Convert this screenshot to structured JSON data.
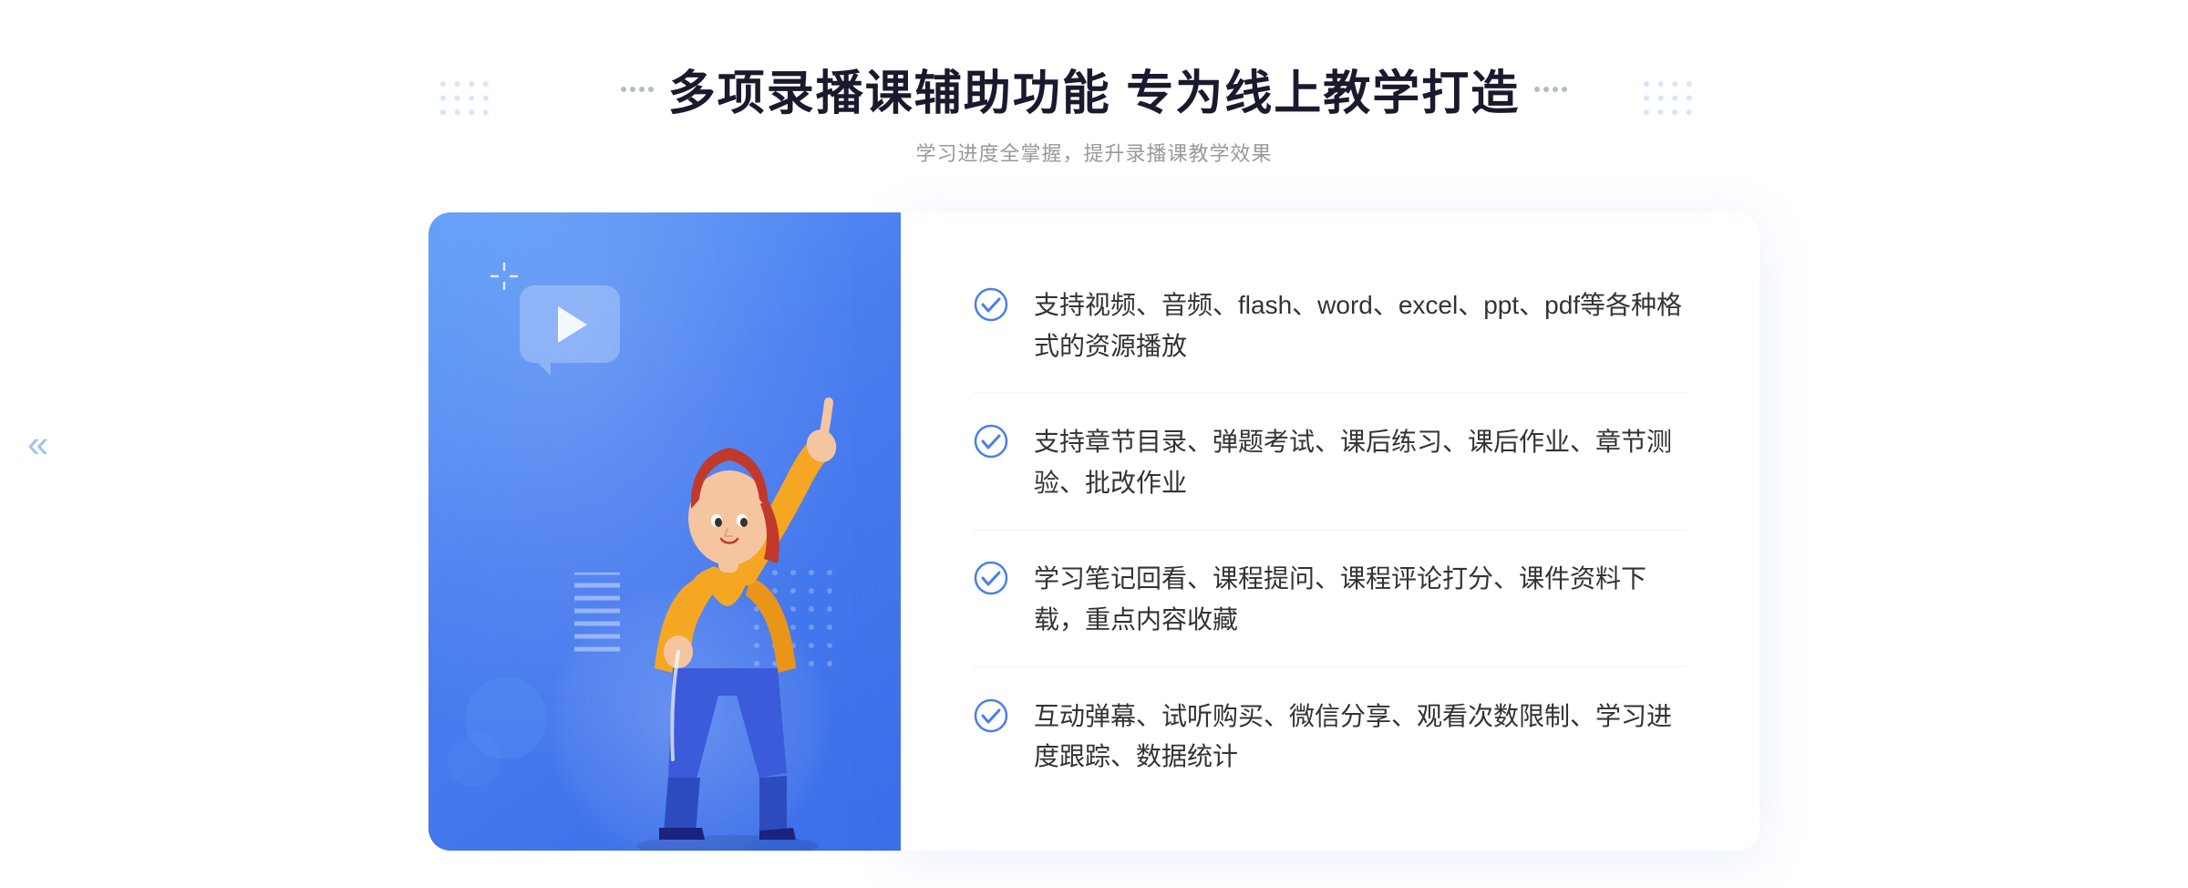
{
  "page": {
    "background": "#ffffff"
  },
  "header": {
    "main_title": "多项录播课辅助功能 专为线上教学打造",
    "sub_title": "学习进度全掌握，提升录播课教学效果"
  },
  "features": [
    {
      "id": 1,
      "text": "支持视频、音频、flash、word、excel、ppt、pdf等各种格式的资源播放"
    },
    {
      "id": 2,
      "text": "支持章节目录、弹题考试、课后练习、课后作业、章节测验、批改作业"
    },
    {
      "id": 3,
      "text": "学习笔记回看、课程提问、课程评论打分、课件资料下载，重点内容收藏"
    },
    {
      "id": 4,
      "text": "互动弹幕、试听购买、微信分享、观看次数限制、学习进度跟踪、数据统计"
    }
  ],
  "icons": {
    "check_circle": "✓",
    "play": "▶",
    "chevrons_left": "«"
  },
  "colors": {
    "primary_blue": "#4a7ef0",
    "light_blue": "#5b9bf8",
    "dark_blue": "#1a4abf",
    "text_dark": "#333333",
    "text_gray": "#999999",
    "accent": "#3a6de8"
  }
}
